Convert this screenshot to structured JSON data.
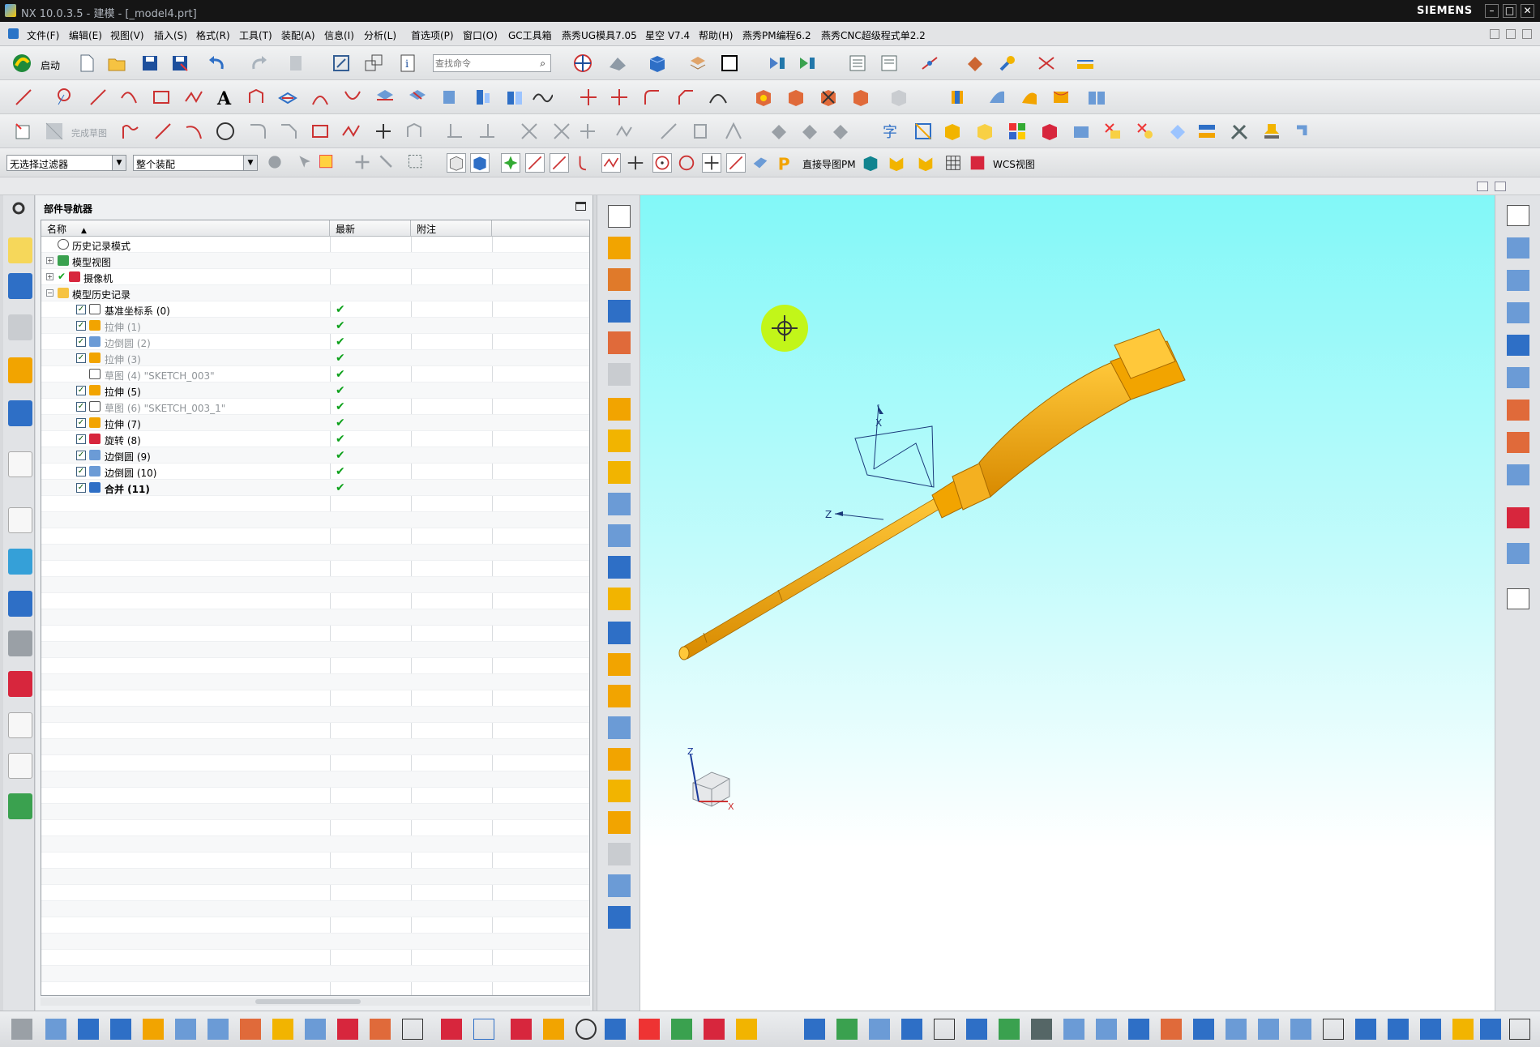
{
  "window": {
    "title": "NX 10.0.3.5 - 建模 - [_model4.prt]",
    "brand": "SIEMENS",
    "controls": [
      "–",
      "□",
      "✕"
    ]
  },
  "menu": {
    "items": [
      "文件(F)",
      "编辑(E)",
      "视图(V)",
      "插入(S)",
      "格式(R)",
      "工具(T)",
      "装配(A)",
      "信息(I)",
      "分析(L)",
      "首选项(P)",
      "窗口(O)",
      "GC工具箱",
      "燕秀UG模具7.05",
      "星空 V7.4",
      "帮助(H)",
      "燕秀PM编程6.2",
      "燕秀CNC超级程式单2.2"
    ]
  },
  "toolbar": {
    "start_label": "启动",
    "search_placeholder": "查找命令",
    "finish_sketch": "完成草图",
    "direct_pm": "直接导图PM",
    "wcs_view": "WCS视图"
  },
  "filters": {
    "selection_filter": "无选择过滤器",
    "assembly_scope": "整个装配"
  },
  "navigator": {
    "title": "部件导航器",
    "columns": [
      "名称",
      "最新",
      "附注"
    ],
    "rows": [
      {
        "label": "历史记录模式",
        "state": "normal"
      },
      {
        "label": "模型视图",
        "state": "normal"
      },
      {
        "label": "摄像机",
        "state": "normal"
      },
      {
        "label": "模型历史记录",
        "state": "normal"
      },
      {
        "label": "基准坐标系 (0)",
        "state": "normal",
        "uptodate": "✔"
      },
      {
        "label": "拉伸 (1)",
        "state": "gray",
        "uptodate": "✔"
      },
      {
        "label": "边倒圆 (2)",
        "state": "gray",
        "uptodate": "✔"
      },
      {
        "label": "拉伸 (3)",
        "state": "gray",
        "uptodate": "✔"
      },
      {
        "label": "草图 (4) \"SKETCH_003\"",
        "state": "gray",
        "uptodate": "✔"
      },
      {
        "label": "拉伸 (5)",
        "state": "normal",
        "uptodate": "✔"
      },
      {
        "label": "草图 (6) \"SKETCH_003_1\"",
        "state": "gray",
        "uptodate": "✔"
      },
      {
        "label": "拉伸 (7)",
        "state": "normal",
        "uptodate": "✔"
      },
      {
        "label": "旋转 (8)",
        "state": "normal",
        "uptodate": "✔"
      },
      {
        "label": "边倒圆 (9)",
        "state": "normal",
        "uptodate": "✔"
      },
      {
        "label": "边倒圆 (10)",
        "state": "normal",
        "uptodate": "✔"
      },
      {
        "label": "合并 (11)",
        "state": "bold",
        "uptodate": "✔"
      }
    ]
  },
  "viewport": {
    "axis_x": "X",
    "axis_z": "Z",
    "triad_x": "X",
    "triad_z": "Z",
    "background_top": "#82f8f8",
    "background_bottom": "#ffffff",
    "part_color": "#f2a400"
  },
  "colors": {
    "titlebar": "#151515",
    "accent_check": "#0da11b"
  }
}
